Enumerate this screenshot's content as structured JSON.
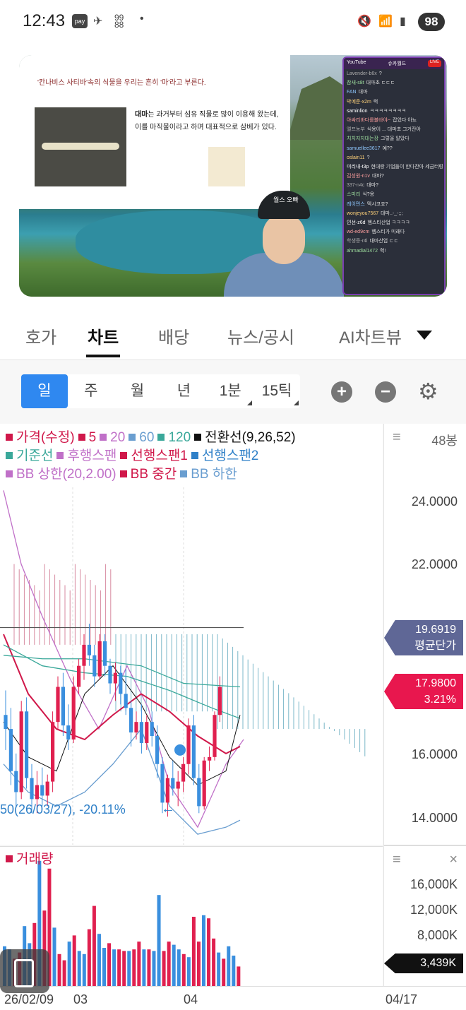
{
  "status": {
    "time": "12:43",
    "pay": "pay",
    "battery": "98"
  },
  "video": {
    "slide_title": "'칸나비스 사티바'속의 식물을 우리는 흔히 '마'라고 부른다.",
    "slide_body_bold": "대마",
    "slide_body": "는 과거부터 섬유 직물로 많이 이용해 왔는데, 이를 마직물이라고 하며 대표적으로 삼베가 있다.",
    "cap_text": "월스 오빠",
    "chat_header": "YouTube",
    "chat_title": "슈카월드",
    "chat_live": "LIVE",
    "chat": [
      {
        "user": "Lavender-b6x",
        "msg": "?"
      },
      {
        "user": "참새-s8t",
        "msg": "대마초 ㄷㄷㄷ"
      },
      {
        "user": "FAN",
        "msg": "대마"
      },
      {
        "user": "박예준-x2m",
        "msg": "럭"
      },
      {
        "user": "saminlion",
        "msg": "ㅋㅋㅋㅋㅋㅋㅋㅋ"
      },
      {
        "user": "아싸리바다를볼바야~",
        "msg": "잡았다 아뇨"
      },
      {
        "user": "엘프농부",
        "msg": "식용이 ... 대마초 그거잔아"
      },
      {
        "user": "치치지지대는장",
        "msg": "그렇울 알았다"
      },
      {
        "user": "samuellee3617",
        "msg": "예??"
      },
      {
        "user": "oslain11",
        "msg": "?"
      },
      {
        "user": "미리내-t3p",
        "msg": "현대랑 기업들이 한다잔아 세금터렁 틀라 해데네."
      },
      {
        "user": "김성원-n1v",
        "msg": "대마?"
      },
      {
        "user": "337-n4c",
        "msg": "대마?"
      },
      {
        "user": "스미리",
        "msg": "식?용"
      },
      {
        "user": "레이먼스",
        "msg": "멕시코죠?"
      },
      {
        "user": "wonjeyou7567",
        "msg": "대마..-_-;;;"
      },
      {
        "user": "인선-z6d",
        "msg": "헴스티산업 ㅋㅋㅋㅋ"
      },
      {
        "user": "wd-ed9cm",
        "msg": "헴스티가 미래다"
      },
      {
        "user": "학생증-r4l",
        "msg": "대마산업 ㄷㄷ"
      },
      {
        "user": "ahmadial1472",
        "msg": "헉!"
      }
    ]
  },
  "tabs": [
    "호가",
    "차트",
    "배당",
    "뉴스/공시",
    "AI차트뷰"
  ],
  "periods": [
    "일",
    "주",
    "월",
    "년",
    "1분",
    "15틱"
  ],
  "legend": {
    "line1": [
      {
        "t": "가격(수정)",
        "c": "#d0184a"
      },
      {
        "t": "5",
        "c": "#d0184a"
      },
      {
        "t": "20",
        "c": "#c070c8"
      },
      {
        "t": "60",
        "c": "#6a9ed0"
      },
      {
        "t": "120",
        "c": "#3aa89a"
      },
      {
        "t": "전환선(9,26,52)",
        "c": "#111111"
      }
    ],
    "line2": [
      {
        "t": "기준선",
        "c": "#3aa89a"
      },
      {
        "t": "후행스팬",
        "c": "#c070c8"
      },
      {
        "t": "선행스팬1",
        "c": "#d0184a"
      },
      {
        "t": "선행스팬2",
        "c": "#2f80c8"
      }
    ],
    "line3": [
      {
        "t": "BB 상한(20,2.00)",
        "c": "#c070c8"
      },
      {
        "t": "BB 중간",
        "c": "#d0184a"
      },
      {
        "t": "BB 하한",
        "c": "#6a9ed0"
      }
    ]
  },
  "bars_label": "48봉",
  "min_annotation": "50(26/03/27), -20.11%",
  "volume_label": "거래량",
  "price_ticks": [
    "24.0000",
    "22.0000",
    "16.0000",
    "14.0000"
  ],
  "avg_price": {
    "value": "19.6919",
    "label": "평균단가"
  },
  "current_price": {
    "value": "17.9800",
    "change": "3.21%"
  },
  "volume_ticks": [
    "16,000K",
    "12,000K",
    "8,000K"
  ],
  "current_volume": "3,439K",
  "x_labels": [
    "26/02/09",
    "03",
    "04",
    "04/17"
  ],
  "chart_data": {
    "type": "candlestick",
    "ylim": [
      13.5,
      25.5
    ],
    "candles": [
      [
        17.2,
        17.9,
        16.2,
        16.8
      ],
      [
        16.8,
        17.4,
        15.2,
        15.6
      ],
      [
        15.6,
        16.1,
        14.6,
        15.0
      ],
      [
        15.0,
        17.6,
        14.8,
        17.3
      ],
      [
        17.3,
        17.7,
        15.1,
        15.4
      ],
      [
        15.4,
        15.8,
        14.4,
        14.8
      ],
      [
        14.8,
        15.6,
        14.4,
        15.2
      ],
      [
        15.2,
        15.7,
        14.6,
        14.9
      ],
      [
        14.9,
        15.5,
        14.6,
        15.3
      ],
      [
        15.3,
        17.3,
        15.0,
        17.0
      ],
      [
        17.0,
        18.3,
        16.8,
        18.0
      ],
      [
        18.0,
        18.4,
        16.6,
        16.9
      ],
      [
        16.9,
        17.5,
        16.2,
        16.5
      ],
      [
        16.5,
        18.3,
        16.4,
        18.0
      ],
      [
        18.0,
        18.8,
        17.8,
        18.6
      ],
      [
        18.6,
        19.5,
        18.2,
        19.2
      ],
      [
        19.2,
        19.8,
        18.6,
        18.9
      ],
      [
        18.9,
        19.2,
        18.0,
        18.3
      ],
      [
        18.3,
        19.5,
        18.2,
        19.3
      ],
      [
        19.3,
        19.5,
        18.3,
        18.6
      ],
      [
        18.6,
        18.8,
        17.8,
        18.1
      ],
      [
        18.1,
        18.7,
        17.6,
        18.4
      ],
      [
        18.4,
        18.6,
        17.5,
        17.8
      ],
      [
        17.8,
        18.5,
        17.2,
        17.4
      ],
      [
        17.4,
        17.6,
        16.3,
        16.7
      ],
      [
        16.7,
        17.3,
        16.5,
        17.0
      ],
      [
        17.0,
        17.5,
        16.1,
        16.4
      ],
      [
        16.4,
        17.2,
        16.2,
        17.0
      ],
      [
        17.0,
        17.3,
        16.3,
        16.6
      ],
      [
        16.6,
        16.9,
        15.4,
        15.8
      ],
      [
        15.8,
        16.0,
        14.4,
        14.7
      ],
      [
        14.7,
        15.5,
        14.3,
        15.4
      ],
      [
        15.4,
        15.9,
        14.9,
        15.1
      ],
      [
        15.1,
        15.6,
        14.6,
        15.3
      ],
      [
        15.3,
        16.0,
        15.0,
        15.8
      ],
      [
        15.8,
        17.1,
        15.5,
        16.9
      ],
      [
        16.9,
        17.2,
        15.2,
        15.4
      ],
      [
        15.4,
        15.8,
        14.4,
        14.6
      ],
      [
        14.6,
        16.0,
        14.5,
        15.9
      ],
      [
        15.9,
        16.3,
        15.6,
        16.0
      ],
      [
        16.0,
        17.3,
        15.9,
        17.2
      ],
      [
        17.2,
        18.3,
        17.0,
        18.0
      ]
    ],
    "volume": [
      5200,
      4800,
      3600,
      4400,
      7800,
      5600,
      8200,
      16200,
      9800,
      15200,
      7600,
      4200,
      3400,
      5800,
      6600,
      4600,
      4200,
      7400,
      10400,
      6800,
      5000,
      5600,
      4800,
      4800,
      4600,
      4600,
      4800,
      5800,
      4800,
      4800,
      4600,
      11800,
      4600,
      5800,
      5400,
      4800,
      4200,
      3800,
      9000,
      5800,
      9200,
      8800,
      6200,
      4400,
      3600,
      5200,
      4000,
      2600
    ],
    "vol_ylim": [
      0,
      18000
    ]
  }
}
